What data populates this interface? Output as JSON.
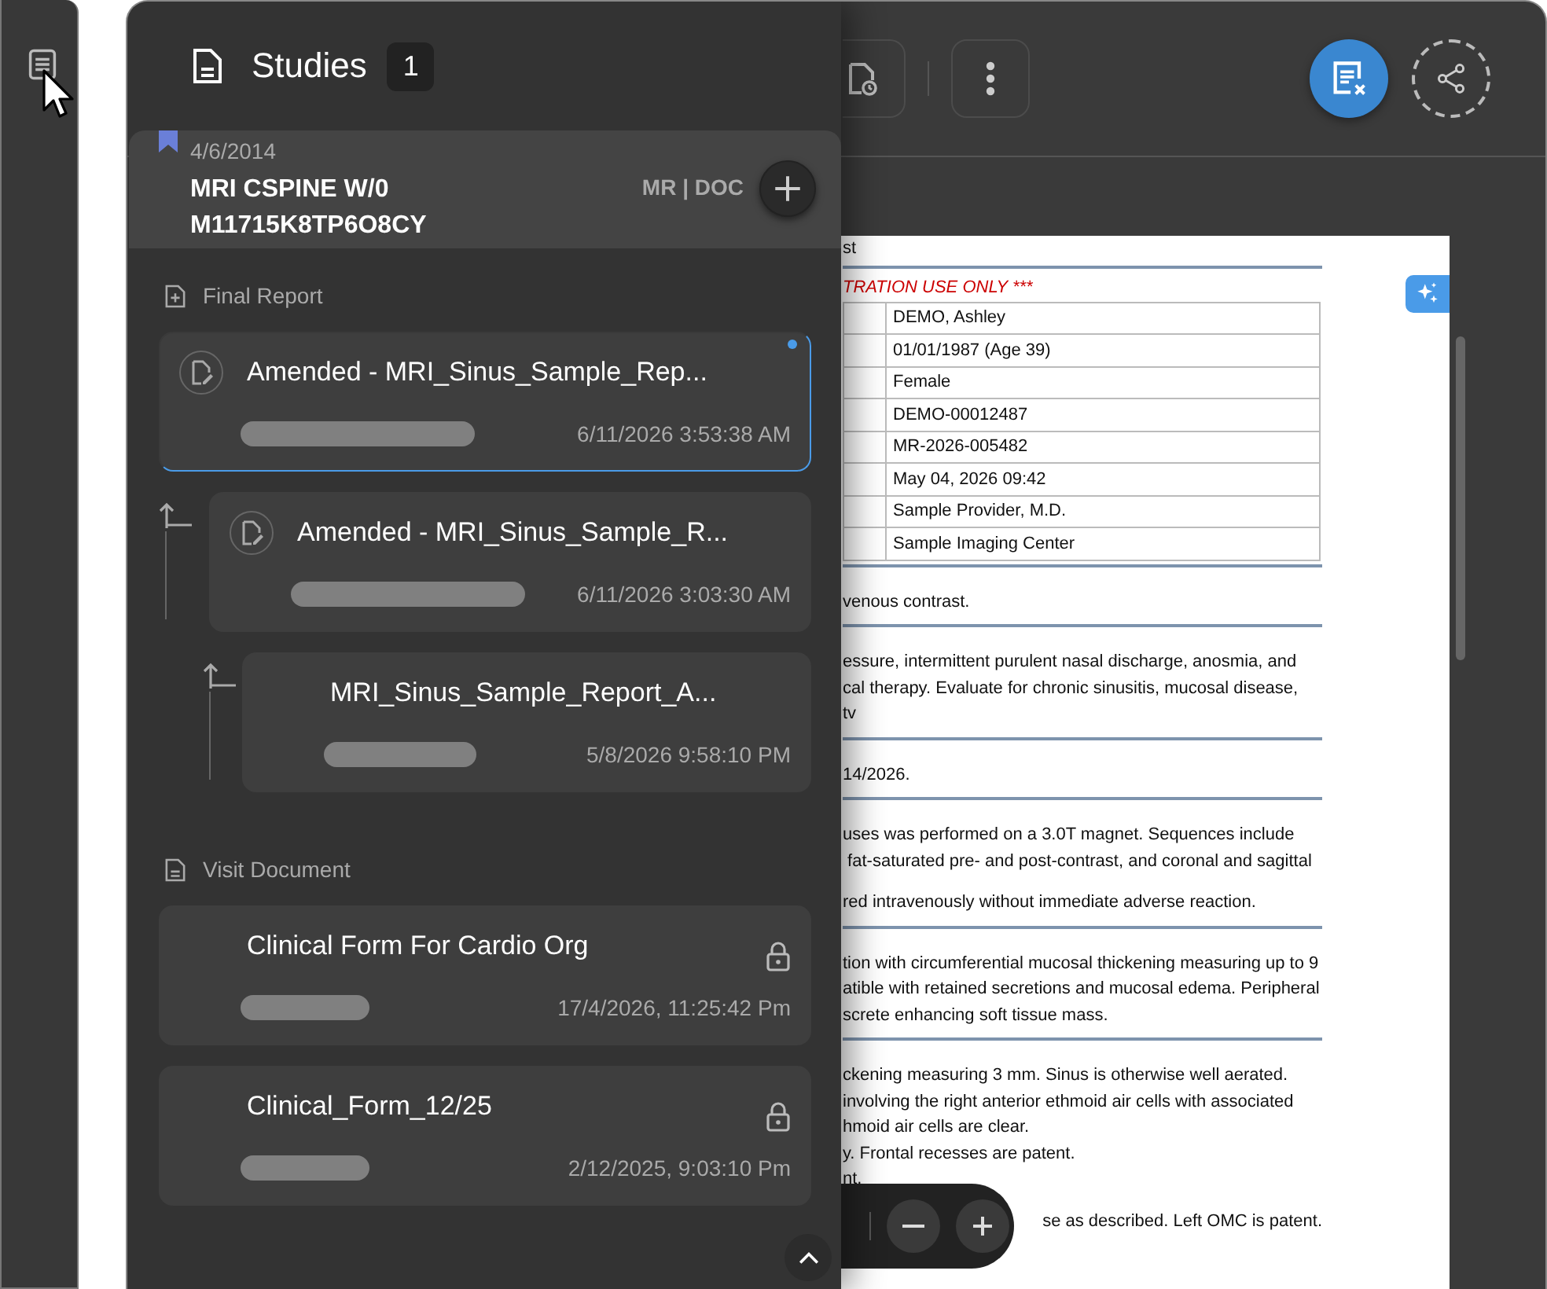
{
  "panel": {
    "title": "Studies",
    "count": "1",
    "study": {
      "bookmarked": true,
      "date": "4/6/2014",
      "name": "MRI CSPINE W/0",
      "accession": "M11715K8TP6O8CY",
      "modalities": "MR | DOC"
    },
    "sections": [
      {
        "title": "Final Report",
        "kind": "report",
        "documents": [
          {
            "kind": "amended",
            "title": "Amended - MRI_Sinus_Sample_Rep...",
            "date": "6/11/2026 3:53:38 AM",
            "selected": true,
            "new": true,
            "locked": false,
            "children": [
              {
                "kind": "amended",
                "title": "Amended - MRI_Sinus_Sample_R...",
                "date": "6/11/2026 3:03:30 AM",
                "selected": false,
                "new": false,
                "locked": false,
                "children": [
                  {
                    "kind": "original",
                    "title": "MRI_Sinus_Sample_Report_A...",
                    "date": "5/8/2026 9:58:10 PM",
                    "selected": false,
                    "new": false,
                    "locked": false
                  }
                ]
              }
            ]
          }
        ]
      },
      {
        "title": "Visit Document",
        "kind": "visit",
        "documents": [
          {
            "kind": "form",
            "title": "Clinical Form For Cardio Org",
            "date": "17/4/2026, 11:25:42 Pm",
            "selected": false,
            "new": false,
            "locked": true
          },
          {
            "kind": "form",
            "title": "Clinical_Form_12/25",
            "date": "2/12/2025, 9:03:10 Pm",
            "selected": false,
            "new": false,
            "locked": true
          }
        ]
      }
    ]
  },
  "document": {
    "heading": "st",
    "notice": "TRATION USE ONLY ***",
    "table_rows": [
      "DEMO, Ashley",
      "01/01/1987 (Age 39)",
      "Female",
      "DEMO-00012487",
      "MR-2026-005482",
      "May 04, 2026  09:42",
      "Sample Provider, M.D.",
      "Sample Imaging Center"
    ],
    "paragraphs": [
      {
        "lines": [
          "venous contrast."
        ],
        "rule_below": true
      },
      {
        "lines": [
          "essure, intermittent purulent nasal discharge, anosmia, and",
          "cal therapy. Evaluate for chronic sinusitis, mucosal disease,",
          "tv"
        ],
        "rule_below": true
      },
      {
        "lines": [
          "14/2026."
        ],
        "rule_below": true
      },
      {
        "lines": [
          "uses was performed on a 3.0T magnet. Sequences include",
          " fat-saturated pre- and post-contrast, and coronal and sagittal"
        ],
        "rule_below": false
      },
      {
        "lines": [
          "red intravenously without immediate adverse reaction."
        ],
        "rule_below": true
      },
      {
        "lines": [
          "tion with circumferential mucosal thickening measuring up to 9",
          "atible with retained secretions and mucosal edema. Peripheral",
          "screte enhancing soft tissue mass."
        ],
        "rule_below": true
      },
      {
        "lines": [
          "ckening measuring 3 mm. Sinus is otherwise well aerated.",
          "involving the right anterior ethmoid air cells with associated",
          "hmoid air cells are clear.",
          "y. Frontal recesses are patent.",
          "nt."
        ],
        "rule_below": false
      },
      {
        "lines": [
          "se as described. Left OMC is patent."
        ],
        "rule_below": false
      }
    ]
  }
}
